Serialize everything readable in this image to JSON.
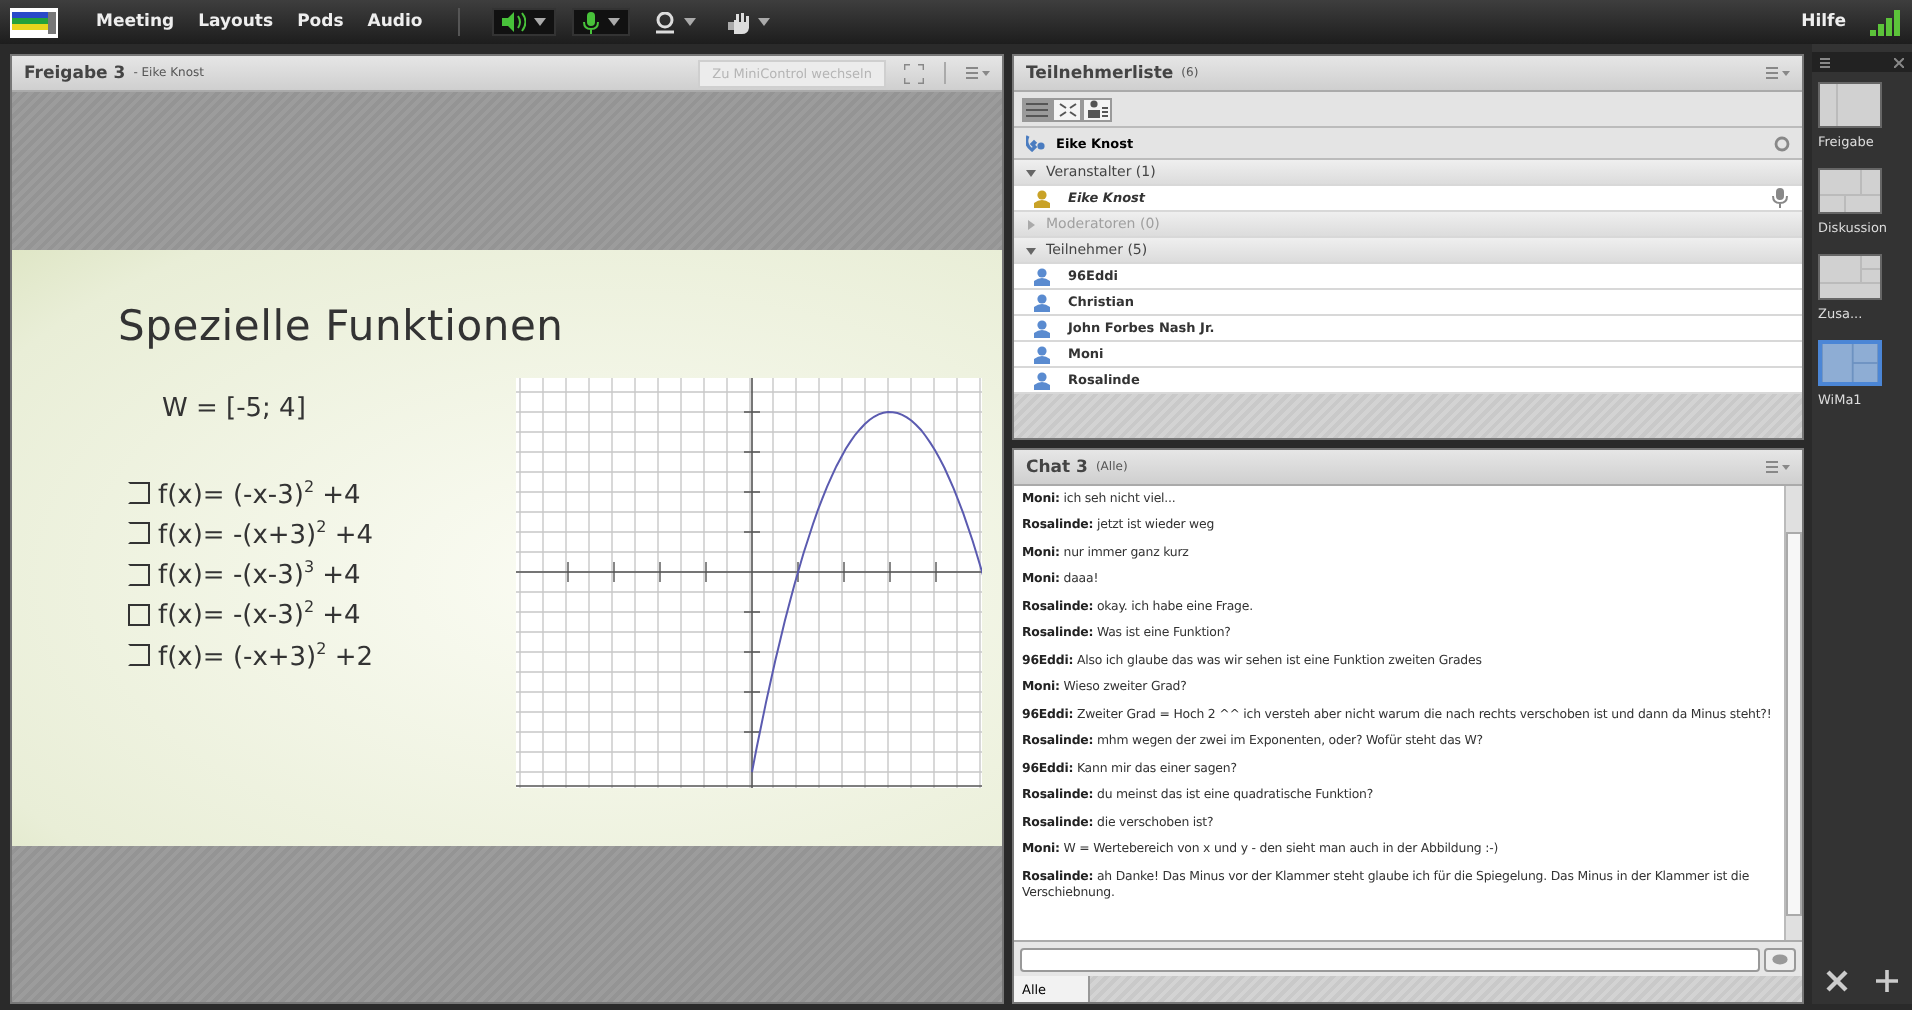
{
  "menu_bar": {
    "menus": [
      "Meeting",
      "Layouts",
      "Pods",
      "Audio"
    ],
    "help": "Hilfe"
  },
  "share_pod": {
    "title": "Freigabe 3",
    "presenter": "- Eike Knost",
    "mini_button": "Zu MiniControl wechseln",
    "slide": {
      "title": "Spezielle Funktionen",
      "range": "W = [-5; 4]",
      "options": [
        "f(x)= (-x-3)$^{2}$ +4",
        "f(x)= -(x+3)$^{2}$ +4",
        "f(x)= -(x-3)$^{3}$ +4",
        "f(x)= -(x-3)$^{2}$ +4",
        "f(x)= (-x+3)$^{2}$ +2"
      ]
    }
  },
  "attendees": {
    "title": "Teilnehmerliste",
    "count": "(6)",
    "views": [
      {
        "kind": "list",
        "selected": true
      },
      {
        "kind": "grid",
        "selected": false
      },
      {
        "kind": "sort",
        "selected": false
      }
    ],
    "me": "Eike Knost",
    "groups": [
      {
        "label": "Veranstalter (1)",
        "expanded": true,
        "kind": "host",
        "members": [
          "Eike Knost"
        ]
      },
      {
        "label": "Moderatoren (0)",
        "expanded": false
      },
      {
        "label": "Teilnehmer (5)",
        "expanded": true,
        "kind": "participant",
        "members": [
          "96Eddi",
          "Christian",
          "John Forbes Nash Jr.",
          "Moni",
          "Rosalinde"
        ]
      }
    ]
  },
  "chat": {
    "title": "Chat 3",
    "scope": "(Alle)",
    "messages": [
      {
        "sender": "Moni:",
        "text": "ich seh nicht viel..."
      },
      {
        "sender": "Rosalinde:",
        "text": "jetzt ist wieder weg"
      },
      {
        "sender": "Moni:",
        "text": "nur immer ganz kurz"
      },
      {
        "sender": "Moni:",
        "text": "daaa!"
      },
      {
        "sender": "Rosalinde:",
        "text": "okay. ich habe eine Frage."
      },
      {
        "sender": "Rosalinde:",
        "text": "Was ist eine Funktion?"
      },
      {
        "sender": "96Eddi:",
        "text": "Also ich glaube das was wir sehen ist eine Funktion zweiten Grades"
      },
      {
        "sender": "Moni:",
        "text": "Wieso zweiter Grad?"
      },
      {
        "sender": "96Eddi:",
        "text": "Zweiter Grad = Hoch 2 ^^ ich versteh aber nicht warum die nach rechts verschoben ist und dann da Minus steht?!"
      },
      {
        "sender": "Rosalinde:",
        "text": "mhm wegen der zwei im Exponenten, oder?  Wofür steht das W?"
      },
      {
        "sender": "96Eddi:",
        "text": "Kann mir das einer sagen?"
      },
      {
        "sender": "Rosalinde:",
        "text": "du meinst das ist eine quadratische Funktion?"
      },
      {
        "sender": "Rosalinde:",
        "text": "die verschoben ist?"
      },
      {
        "sender": "Moni:",
        "text": "W = Wertebereich von x und y - den sieht man auch in der Abbildung :-)"
      },
      {
        "sender": "Rosalinde:",
        "text": "ah Danke! Das Minus vor der Klammer steht glaube ich für die Spiegelung. Das Minus in der Klammer ist die Verschiebnung."
      }
    ],
    "tab": "Alle"
  },
  "layouts": [
    {
      "label": "Freigabe",
      "kind": "share",
      "selected": false
    },
    {
      "label": "Diskussion",
      "kind": "discussion",
      "selected": false
    },
    {
      "label": "Zusa...",
      "kind": "collab",
      "selected": false
    },
    {
      "label": "WiMa1",
      "kind": "custom",
      "selected": true
    }
  ]
}
